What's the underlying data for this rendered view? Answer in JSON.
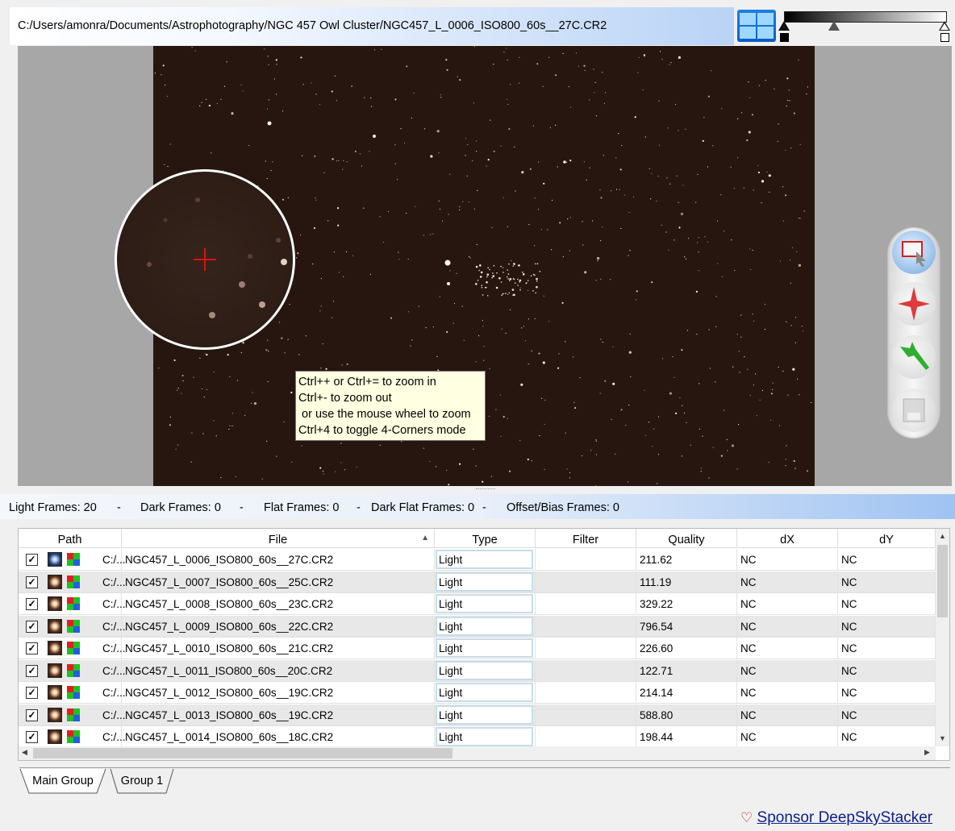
{
  "file_path": "C:/Users/amonra/Documents/Astrophotography/NGC 457 Owl Cluster/NGC457_L_0006_ISO800_60s__27C.CR2",
  "tooltip": {
    "lines": [
      "Ctrl++ or Ctrl+= to zoom in",
      "Ctrl+- to zoom out",
      " or use the mouse wheel to zoom",
      "Ctrl+4 to toggle 4-Corners mode"
    ]
  },
  "viewer_tools": [
    "select-rectangle-icon",
    "edit-stars-icon",
    "edit-comet-icon",
    "save-icon"
  ],
  "frame_counts": {
    "light": "Light Frames: 20",
    "dark": "Dark Frames: 0",
    "flat": "Flat Frames: 0",
    "dark_flat": "Dark Flat Frames: 0",
    "offset": "Offset/Bias Frames: 0",
    "separator": "-"
  },
  "table": {
    "columns": [
      "Path",
      "File",
      "Type",
      "Filter",
      "Quality",
      "dX",
      "dY"
    ],
    "sorted_column": "File",
    "rows": [
      {
        "checked": true,
        "path": "C:/...",
        "file": "NGC457_L_0006_ISO800_60s__27C.CR2",
        "type": "Light",
        "filter": "",
        "quality": "211.62",
        "dx": "NC",
        "dy": "NC"
      },
      {
        "checked": true,
        "path": "C:/...",
        "file": "NGC457_L_0007_ISO800_60s__25C.CR2",
        "type": "Light",
        "filter": "",
        "quality": "111.19",
        "dx": "NC",
        "dy": "NC"
      },
      {
        "checked": true,
        "path": "C:/...",
        "file": "NGC457_L_0008_ISO800_60s__23C.CR2",
        "type": "Light",
        "filter": "",
        "quality": "329.22",
        "dx": "NC",
        "dy": "NC"
      },
      {
        "checked": true,
        "path": "C:/...",
        "file": "NGC457_L_0009_ISO800_60s__22C.CR2",
        "type": "Light",
        "filter": "",
        "quality": "796.54",
        "dx": "NC",
        "dy": "NC"
      },
      {
        "checked": true,
        "path": "C:/...",
        "file": "NGC457_L_0010_ISO800_60s__21C.CR2",
        "type": "Light",
        "filter": "",
        "quality": "226.60",
        "dx": "NC",
        "dy": "NC"
      },
      {
        "checked": true,
        "path": "C:/...",
        "file": "NGC457_L_0011_ISO800_60s__20C.CR2",
        "type": "Light",
        "filter": "",
        "quality": "122.71",
        "dx": "NC",
        "dy": "NC"
      },
      {
        "checked": true,
        "path": "C:/...",
        "file": "NGC457_L_0012_ISO800_60s__19C.CR2",
        "type": "Light",
        "filter": "",
        "quality": "214.14",
        "dx": "NC",
        "dy": "NC"
      },
      {
        "checked": true,
        "path": "C:/...",
        "file": "NGC457_L_0013_ISO800_60s__19C.CR2",
        "type": "Light",
        "filter": "",
        "quality": "588.80",
        "dx": "NC",
        "dy": "NC"
      },
      {
        "checked": true,
        "path": "C:/...",
        "file": "NGC457_L_0014_ISO800_60s__18C.CR2",
        "type": "Light",
        "filter": "",
        "quality": "198.44",
        "dx": "NC",
        "dy": "NC"
      }
    ]
  },
  "tabs": [
    {
      "label": "Main Group",
      "active": true
    },
    {
      "label": "Group 1",
      "active": false
    }
  ],
  "sponsor": {
    "label": "Sponsor DeepSkyStacker",
    "icon": "heart-icon"
  },
  "colors": {
    "accent_blue": "#9fc3f2",
    "image_bg": "#26160f",
    "crosshair": "#e01010",
    "link": "#0b1d8c"
  }
}
